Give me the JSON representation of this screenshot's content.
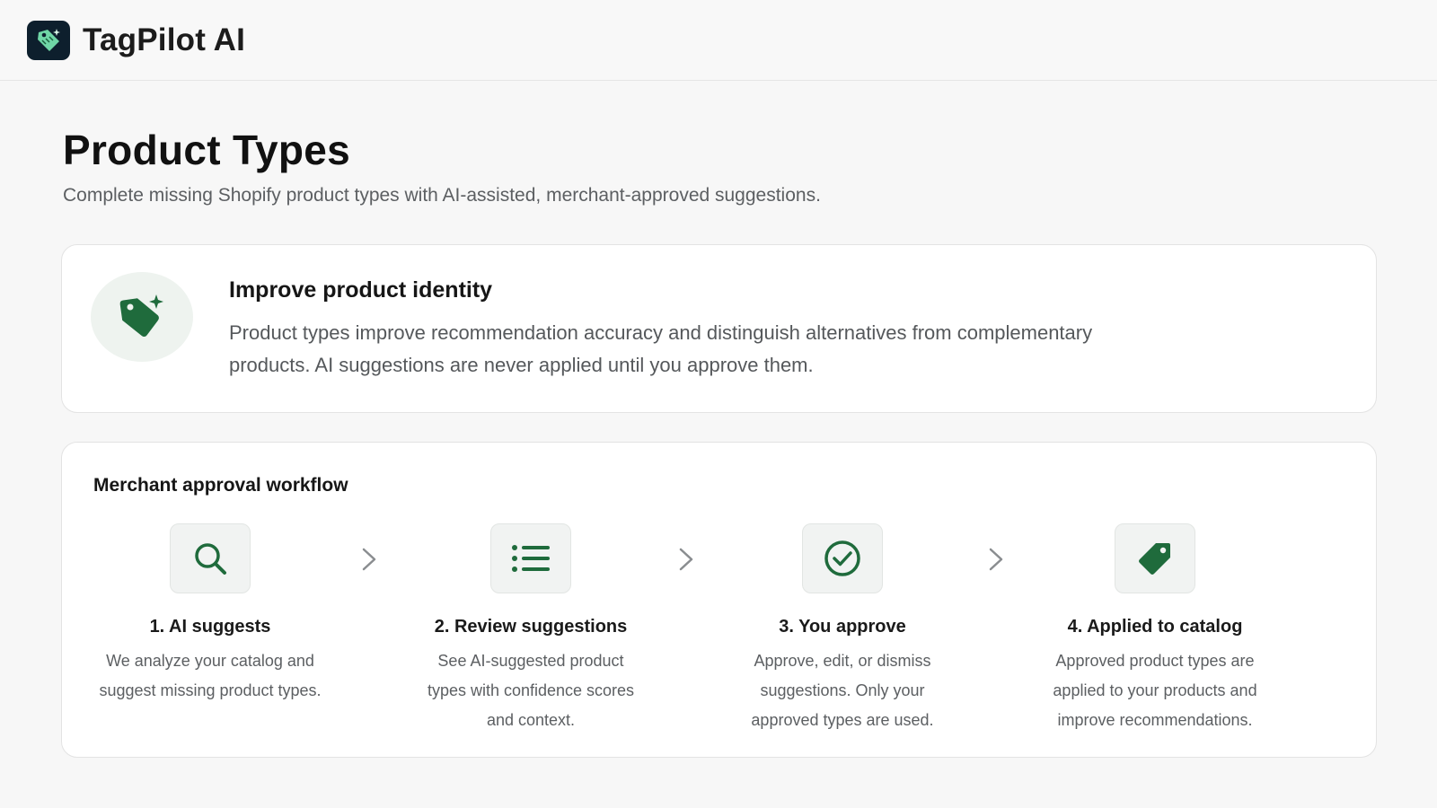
{
  "header": {
    "app_name": "TagPilot AI",
    "logo_icon": "tag-logo-icon"
  },
  "page": {
    "title": "Product Types",
    "subtitle": "Complete missing Shopify product types with AI-assisted, merchant-approved suggestions."
  },
  "identity_card": {
    "icon": "tag-sparkle-icon",
    "title": "Improve product identity",
    "text": "Product types improve recommendation accuracy and distinguish alternatives from complementary products. AI suggestions are never applied until you approve them."
  },
  "workflow": {
    "title": "Merchant approval workflow",
    "steps": [
      {
        "icon": "search-icon",
        "title": "1. AI suggests",
        "description": "We analyze your catalog and suggest missing product types."
      },
      {
        "icon": "list-icon",
        "title": "2. Review suggestions",
        "description": "See AI-suggested product types with confidence scores and context."
      },
      {
        "icon": "check-circle-icon",
        "title": "3. You approve",
        "description": "Approve, edit, or dismiss suggestions. Only your approved types are used."
      },
      {
        "icon": "tag-icon",
        "title": "4. Applied to catalog",
        "description": "Approved product types are applied to your products and improve recommendations."
      }
    ]
  },
  "colors": {
    "accent_green": "#1f6b3c",
    "icon_bg": "#eef3ef",
    "logo_bg": "#0d1f2d"
  }
}
